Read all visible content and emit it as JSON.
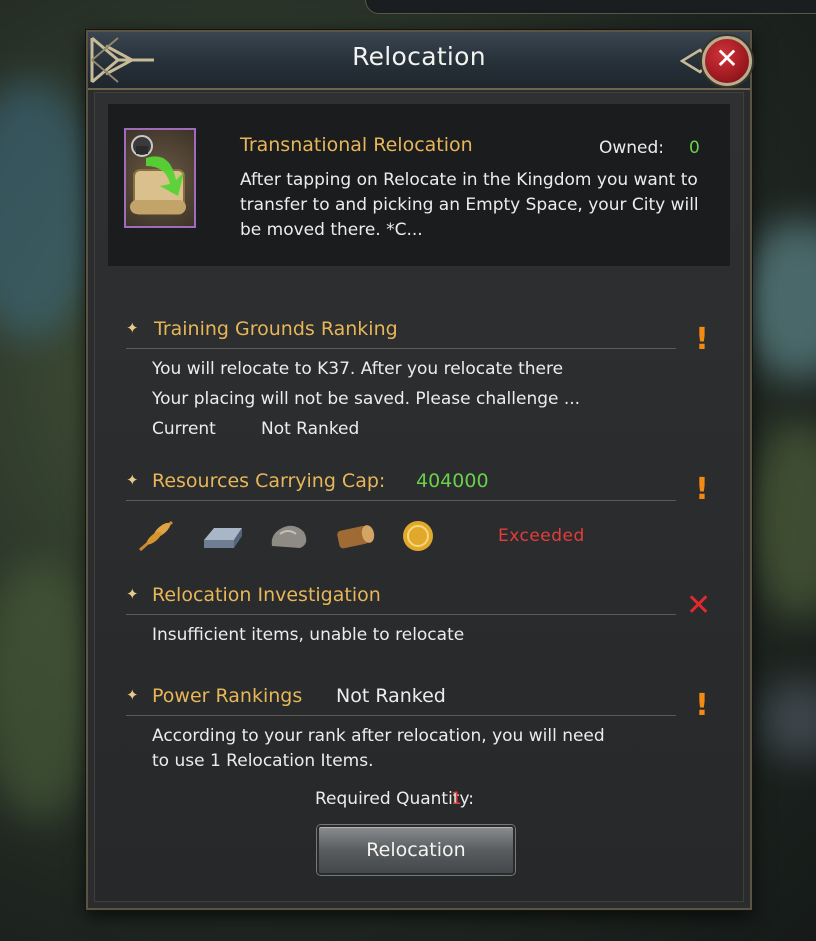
{
  "dialog": {
    "title": "Relocation",
    "close_icon": "close-x-icon"
  },
  "item": {
    "name": "Transnational Relocation",
    "owned_label": "Owned:",
    "owned_value": "0",
    "description": "After tapping on Relocate in the Kingdom you want to transfer to and picking an Empty Space, your City will be moved there. *C...",
    "icon": "relocation-scroll-icon"
  },
  "sections": {
    "training": {
      "title": "Training Grounds Ranking",
      "line1": "You will relocate to K37. After you relocate there",
      "line2": "Your placing will not be saved. Please challenge ...",
      "current_label": "Current",
      "current_value": "Not Ranked",
      "status_icon": "warning-icon"
    },
    "resources": {
      "title": "Resources Carrying Cap:",
      "value": "404000",
      "status": "Exceeded",
      "icons": [
        "grain-icon",
        "iron-ingot-icon",
        "stone-icon",
        "wood-log-icon",
        "gold-coin-icon"
      ],
      "status_icon": "warning-icon"
    },
    "investigation": {
      "title": "Relocation Investigation",
      "text": "Insufficient items, unable to relocate",
      "status_icon": "fail-x-icon"
    },
    "power": {
      "title": "Power Rankings",
      "value": "Not Ranked",
      "line1": "According to your rank after relocation, you will need",
      "line2": "to use 1 Relocation Items.",
      "status_icon": "warning-icon"
    }
  },
  "footer": {
    "required_label": "Required Quantity:",
    "required_value": "1",
    "button_label": "Relocation"
  },
  "colors": {
    "accent_gold": "#e7b659",
    "owned_green": "#6ccf49",
    "cap_green": "#6ccf49",
    "warning_orange": "#f28a14",
    "error_red": "#e43d3a"
  }
}
